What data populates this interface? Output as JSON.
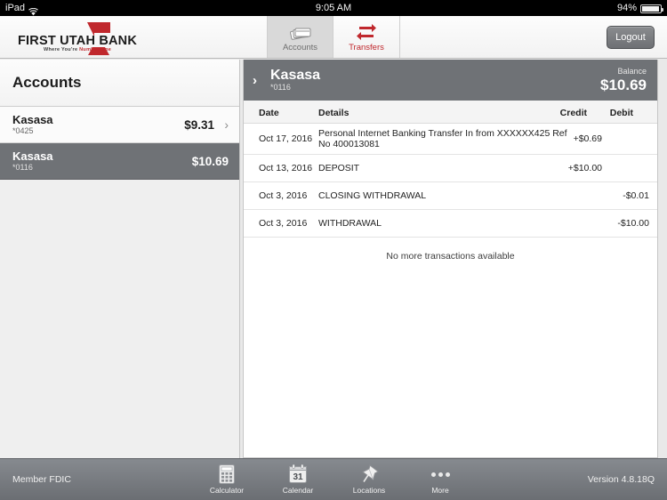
{
  "status_bar": {
    "device": "iPad",
    "wifi_icon": "wifi-icon",
    "time": "9:05 AM",
    "battery_percent": "94%"
  },
  "nav": {
    "logo": {
      "name": "FIRST UTAH BANK",
      "tagline_prefix": "Where You're ",
      "tagline_accent": "Number One",
      "mark_icon": "red-arrow-logo-icon"
    },
    "tabs": [
      {
        "label": "Accounts",
        "icon": "cards-stack-icon",
        "active": true
      },
      {
        "label": "Transfers",
        "icon": "transfer-arrows-icon",
        "active": false
      }
    ],
    "logout_label": "Logout"
  },
  "sidebar": {
    "title": "Accounts",
    "items": [
      {
        "name": "Kasasa",
        "number": "*0425",
        "balance": "$9.31",
        "selected": false,
        "chevron": "chevron-right-icon"
      },
      {
        "name": "Kasasa",
        "number": "*0116",
        "balance": "$10.69",
        "selected": true
      }
    ]
  },
  "detail": {
    "header": {
      "chevron_icon": "chevron-right-icon",
      "account_name": "Kasasa",
      "account_number": "*0116",
      "balance_label": "Balance",
      "balance_amount": "$10.69"
    },
    "columns": {
      "date": "Date",
      "details": "Details",
      "credit": "Credit",
      "debit": "Debit"
    },
    "transactions": [
      {
        "date": "Oct 17, 2016",
        "description": "Personal Internet Banking Transfer In from XXXXXX425 Ref No 400013081",
        "credit": "+$0.69",
        "debit": ""
      },
      {
        "date": "Oct 13, 2016",
        "description": "DEPOSIT",
        "credit": "+$10.00",
        "debit": ""
      },
      {
        "date": "Oct 3, 2016",
        "description": "CLOSING WITHDRAWAL",
        "credit": "",
        "debit": "-$0.01"
      },
      {
        "date": "Oct 3, 2016",
        "description": "WITHDRAWAL",
        "credit": "",
        "debit": "-$10.00"
      }
    ],
    "end_of_list": "No more transactions available"
  },
  "toolbar": {
    "fdic_text": "Member FDIC",
    "version_text": "Version 4.8.18Q",
    "items": [
      {
        "label": "Calculator",
        "icon": "calculator-icon"
      },
      {
        "label": "Calendar",
        "icon": "calendar-icon",
        "day": "31"
      },
      {
        "label": "Locations",
        "icon": "pushpin-icon"
      },
      {
        "label": "More",
        "icon": "ellipsis-icon"
      }
    ]
  },
  "colors": {
    "brand_red": "#c0282d",
    "selection_gray": "#6f7276",
    "toolbar_gray": "#7a7d82"
  }
}
